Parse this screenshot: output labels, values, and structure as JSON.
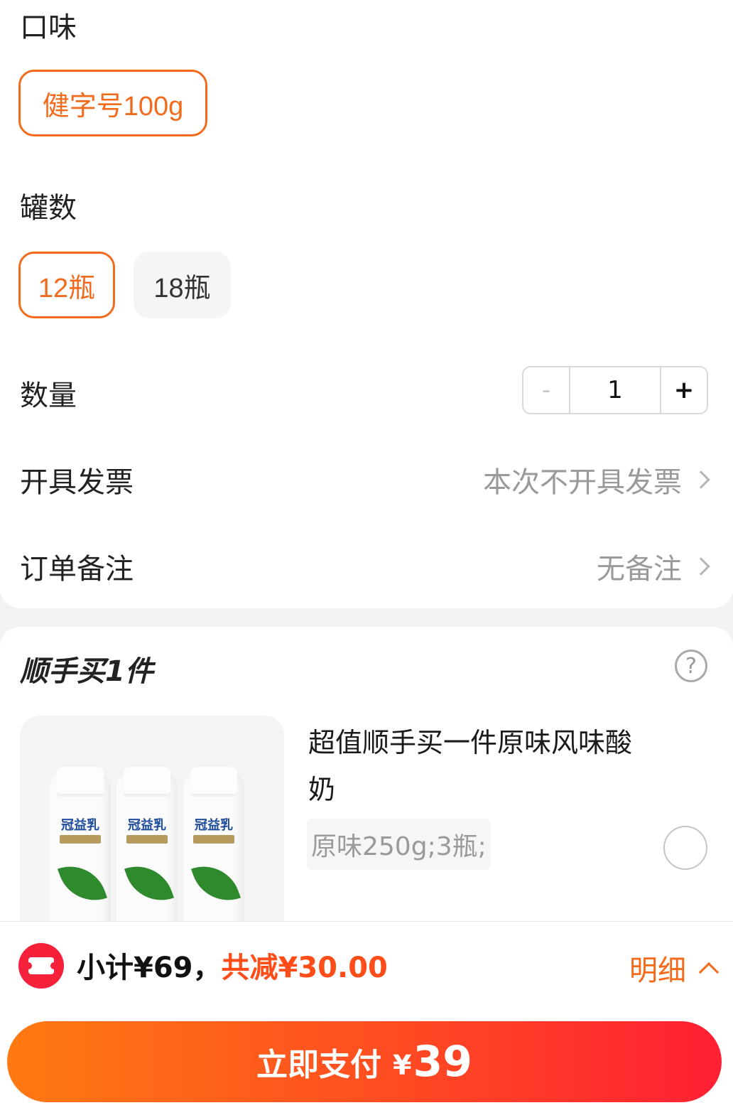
{
  "flavor": {
    "label": "口味",
    "options": [
      "健字号100g"
    ]
  },
  "cans": {
    "label": "罐数",
    "options": [
      "12瓶",
      "18瓶"
    ]
  },
  "quantity": {
    "label": "数量",
    "minus": "-",
    "value": "1",
    "plus": "+"
  },
  "invoice": {
    "label": "开具发票",
    "value": "本次不开具发票"
  },
  "remark": {
    "label": "订单备注",
    "value": "无备注"
  },
  "addon": {
    "title": "顺手买1件",
    "help": "?",
    "product": {
      "title": "超值顺手买一件原味风味酸奶",
      "spec": "原味250g;3瓶;",
      "brand": "冠益乳"
    }
  },
  "footer": {
    "subtotal": "小计¥69，",
    "discount": "共减¥30.00",
    "detail": "明细",
    "pay_label": "立即支付",
    "pay_currency": "¥",
    "pay_amount": "39"
  },
  "colors": {
    "accent": "#f26a1b",
    "pay_start": "#ff7a12",
    "pay_end": "#ff1f34"
  }
}
